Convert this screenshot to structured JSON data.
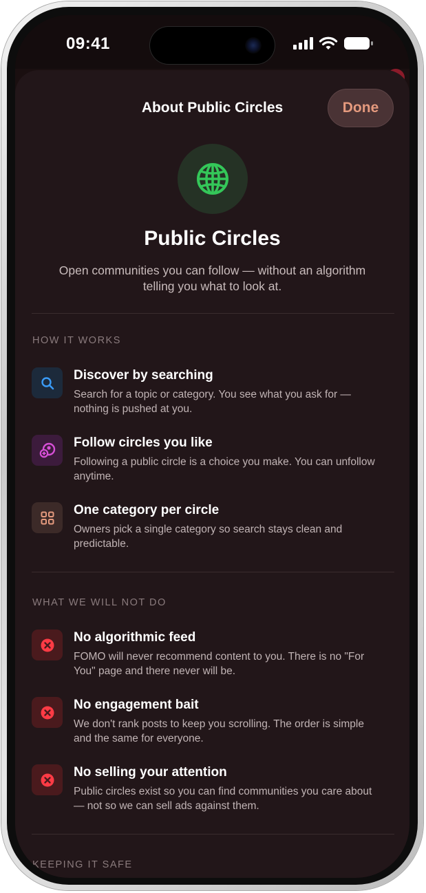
{
  "status_bar": {
    "time": "09:41"
  },
  "sheet": {
    "title": "About Public Circles",
    "done_label": "Done",
    "hero_title": "Public Circles",
    "hero_description": "Open communities you can follow — without an algorithm telling you what to look at."
  },
  "sections": [
    {
      "header": "HOW IT WORKS",
      "items": [
        {
          "icon": "search-icon",
          "title": "Discover by searching",
          "description": "Search for a topic or category. You see what you ask for — nothing is pushed at you."
        },
        {
          "icon": "follow-circle-icon",
          "title": "Follow circles you like",
          "description": "Following a public circle is a choice you make. You can unfollow anytime."
        },
        {
          "icon": "grid-icon",
          "title": "One category per circle",
          "description": "Owners pick a single category so search stays clean and predictable."
        }
      ]
    },
    {
      "header": "WHAT WE WILL NOT DO",
      "items": [
        {
          "icon": "x-circle-icon",
          "title": "No algorithmic feed",
          "description": "FOMO will never recommend content to you. There is no \"For You\" page and there never will be."
        },
        {
          "icon": "x-circle-icon",
          "title": "No engagement bait",
          "description": "We don't rank posts to keep you scrolling. The order is simple and the same for everyone."
        },
        {
          "icon": "x-circle-icon",
          "title": "No selling your attention",
          "description": "Public circles exist so you can find communities you care about — not so we can sell ads against them."
        }
      ]
    },
    {
      "header": "KEEPING IT SAFE"
    }
  ],
  "colors": {
    "accent": "#e59a7e",
    "globe": "#34c759",
    "search": "#3a9bf5",
    "follow": "#d64fd6",
    "category": "#e59a7e",
    "negative": "#ff3b45"
  }
}
